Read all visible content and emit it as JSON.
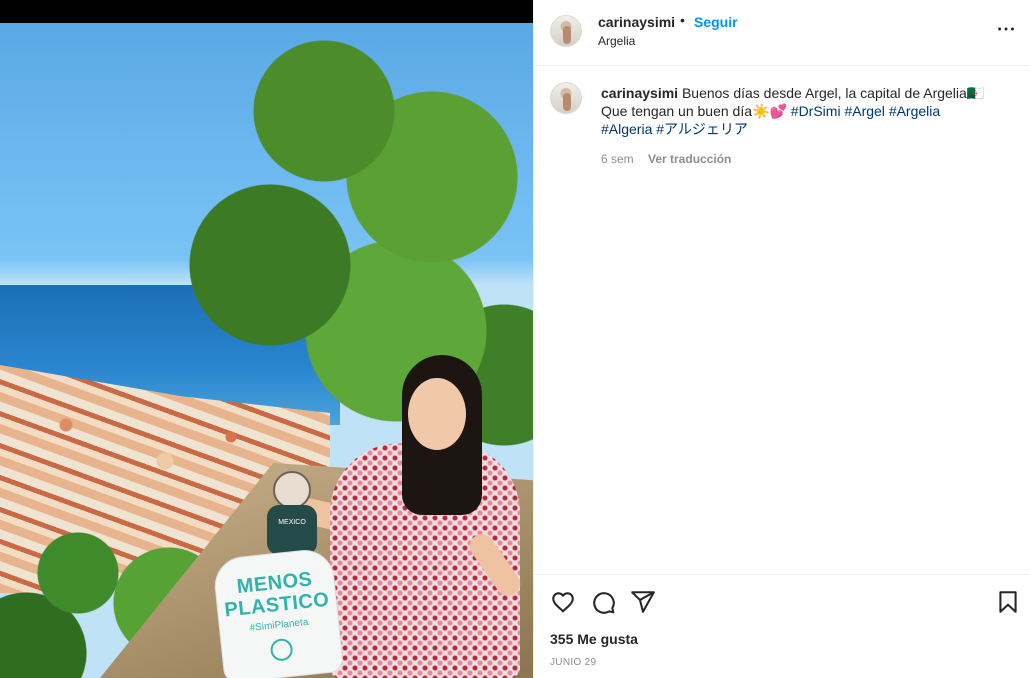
{
  "photo": {
    "bag_text": [
      "MENOS",
      "PLASTICO",
      "#SimiPlaneta"
    ],
    "shirt_text": "MEXICO"
  },
  "post_header": {
    "username": "carinaysimi",
    "separator": "•",
    "follow_label": "Seguir",
    "location": "Argelia",
    "more_icon": "more-horizontal-icon"
  },
  "caption": {
    "username": "carinaysimi",
    "text_line1": "Buenos días desde Argel, la capital de Argelia🇩🇿",
    "text_line2_prefix": "Que tengan un buen día☀️💕",
    "hashtags": [
      "#DrSimi",
      "#Argel",
      "#Argelia",
      "#Algeria",
      "#アルジェリア"
    ],
    "time_ago": "6 sem",
    "translate_label": "Ver traducción"
  },
  "actions": {
    "icons": [
      "heart-icon",
      "comment-icon",
      "share-icon",
      "bookmark-icon"
    ],
    "likes": "355 Me gusta",
    "date": "JUNIO 29"
  },
  "colors": {
    "accent": "#0095f6",
    "hashtag": "#00376b",
    "muted": "#8e8e8e",
    "text": "#262626"
  }
}
